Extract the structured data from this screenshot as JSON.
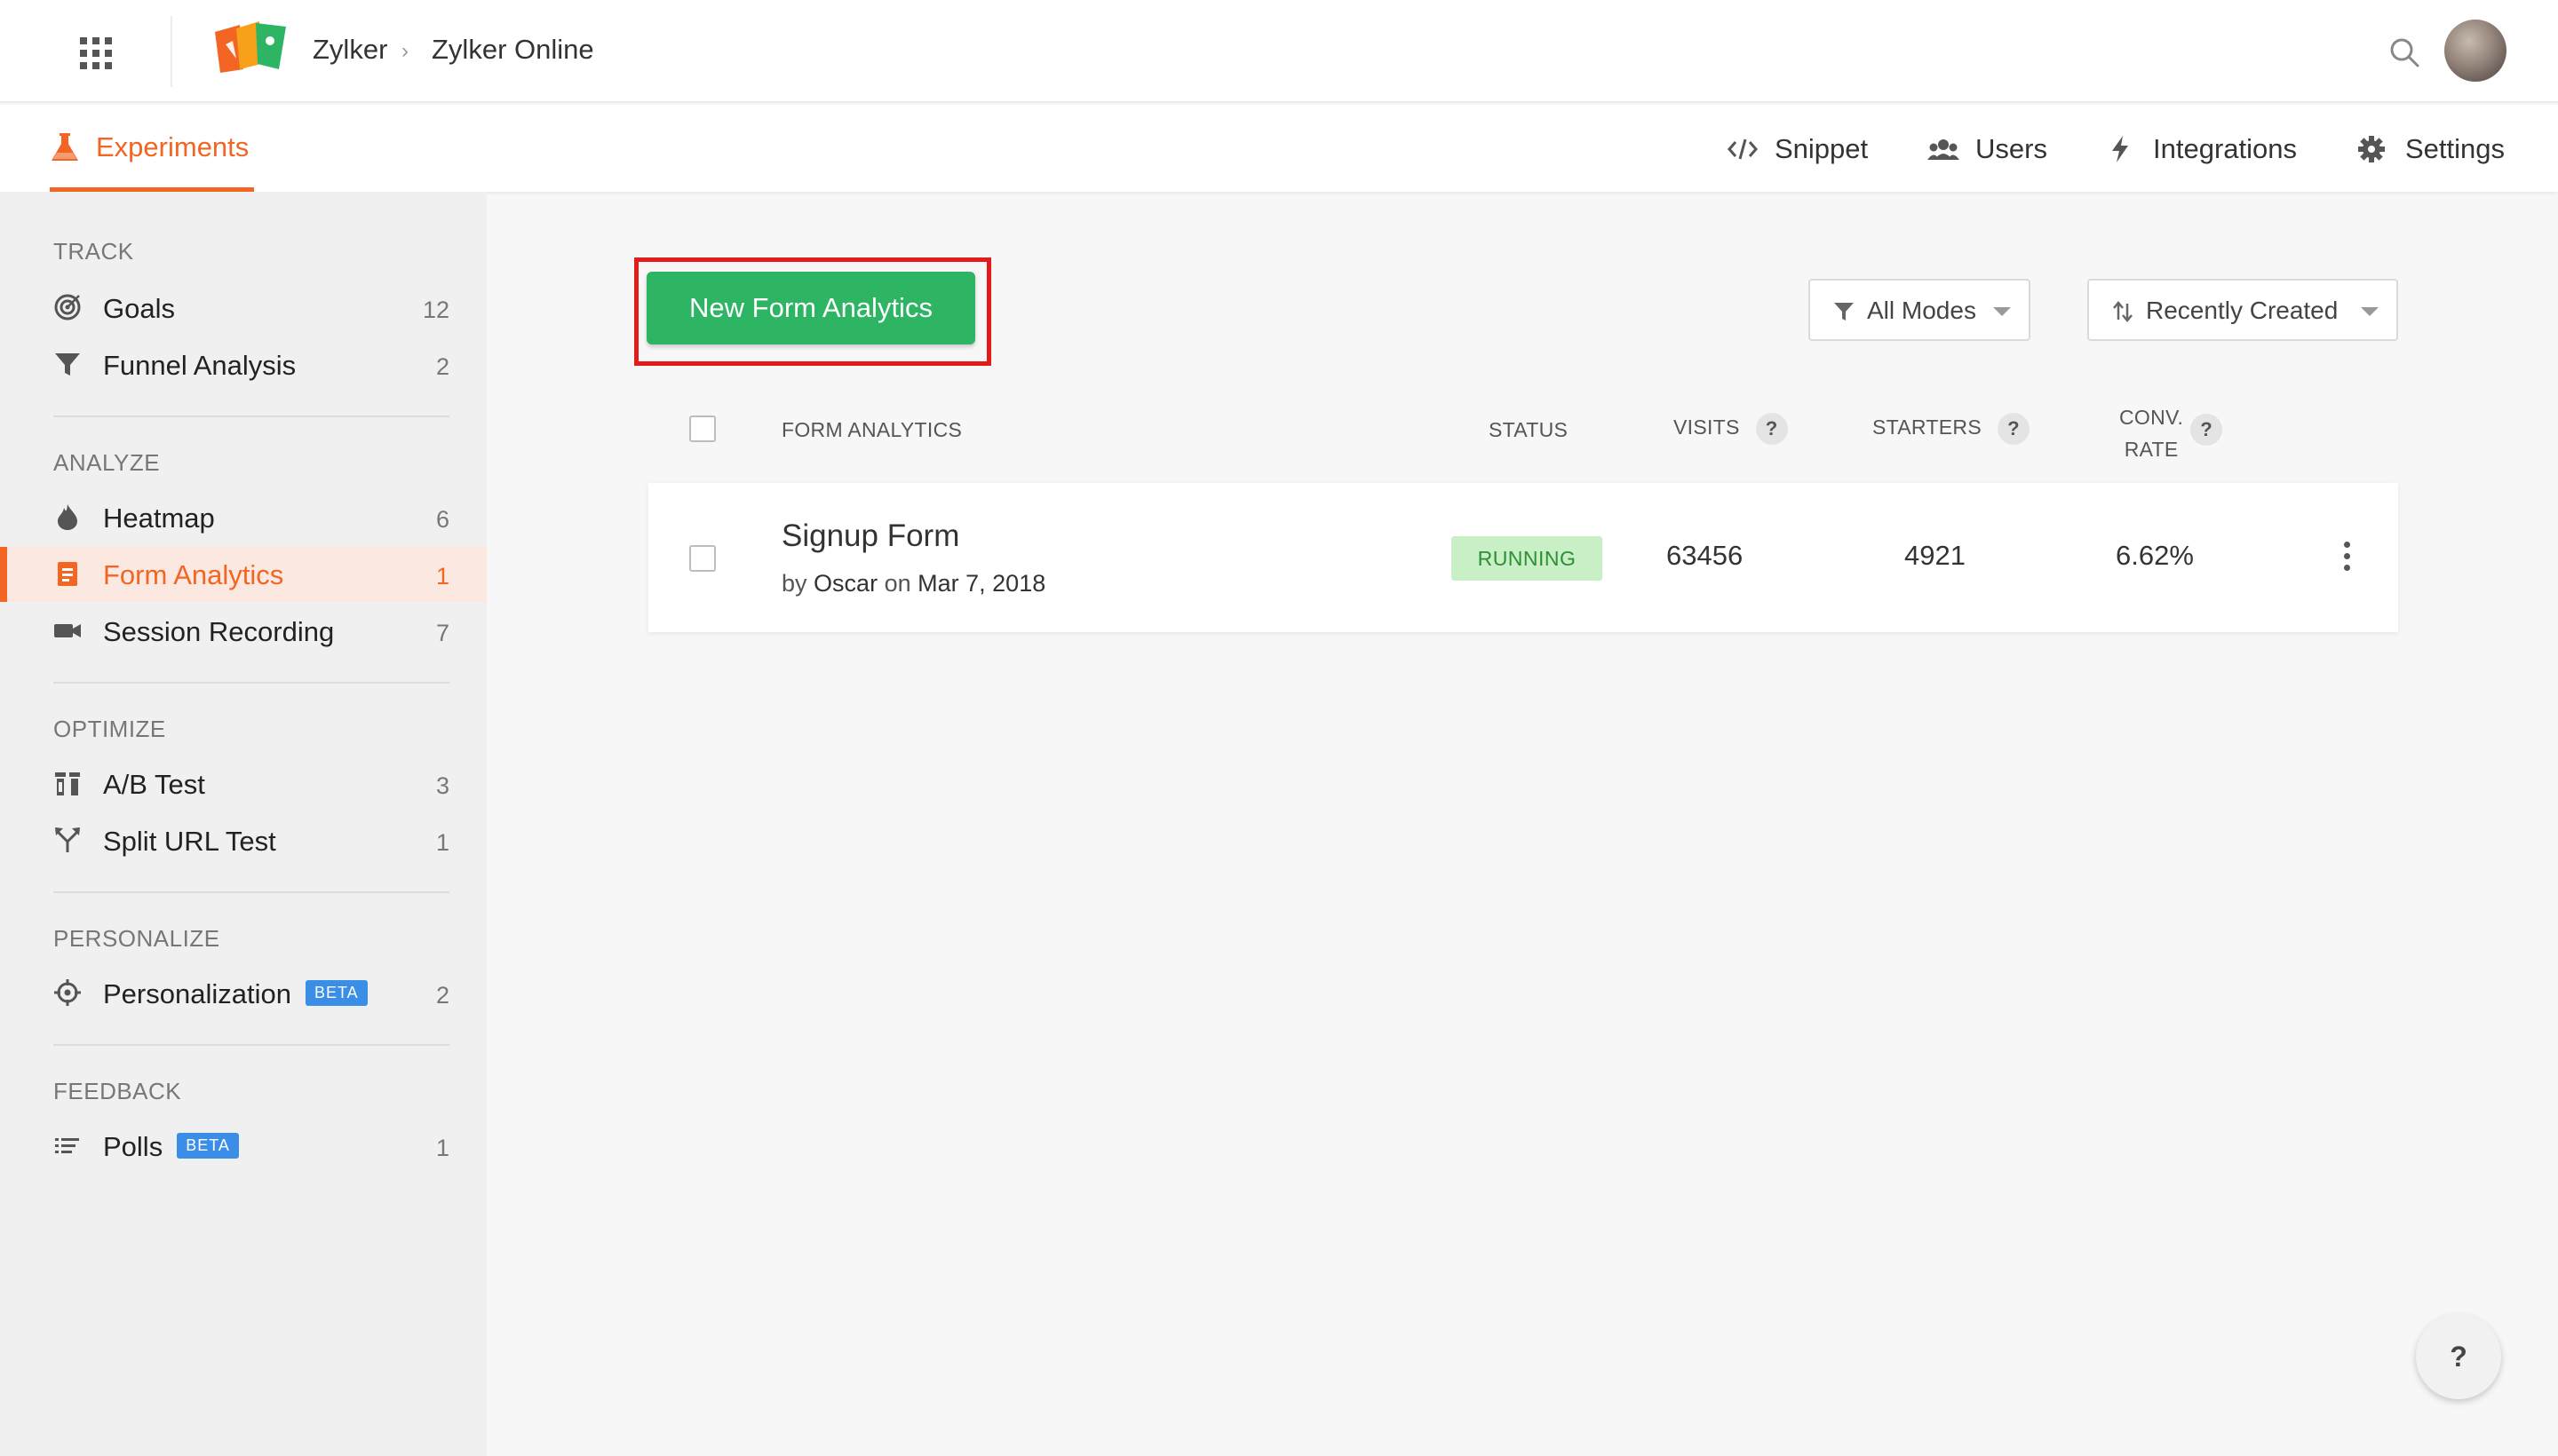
{
  "header": {
    "breadcrumb": [
      "Zylker",
      "Zylker Online"
    ]
  },
  "subnav": {
    "active_tab": "Experiments",
    "links": [
      "Snippet",
      "Users",
      "Integrations",
      "Settings"
    ]
  },
  "sidebar": {
    "sections": [
      {
        "title": "TRACK",
        "items": [
          {
            "label": "Goals",
            "count": "12",
            "icon": "target-icon"
          },
          {
            "label": "Funnel Analysis",
            "count": "2",
            "icon": "funnel-icon"
          }
        ]
      },
      {
        "title": "ANALYZE",
        "items": [
          {
            "label": "Heatmap",
            "count": "6",
            "icon": "flame-icon"
          },
          {
            "label": "Form Analytics",
            "count": "1",
            "icon": "form-icon",
            "active": true
          },
          {
            "label": "Session Recording",
            "count": "7",
            "icon": "video-camera-icon"
          }
        ]
      },
      {
        "title": "OPTIMIZE",
        "items": [
          {
            "label": "A/B Test",
            "count": "3",
            "icon": "ab-test-icon"
          },
          {
            "label": "Split URL Test",
            "count": "1",
            "icon": "split-arrow-icon"
          }
        ]
      },
      {
        "title": "PERSONALIZE",
        "items": [
          {
            "label": "Personalization",
            "count": "2",
            "icon": "crosshair-icon",
            "badge": "BETA"
          }
        ]
      },
      {
        "title": "FEEDBACK",
        "items": [
          {
            "label": "Polls",
            "count": "1",
            "icon": "list-icon",
            "badge": "BETA"
          }
        ]
      }
    ]
  },
  "toolbar": {
    "new_button": "New Form Analytics",
    "mode_filter": "All Modes",
    "sort": "Recently Created"
  },
  "table": {
    "headers": {
      "name": "FORM ANALYTICS",
      "status": "STATUS",
      "visits": "VISITS",
      "starters": "STARTERS",
      "conv_line1": "CONV.",
      "conv_line2": "RATE"
    },
    "help_glyph": "?",
    "rows": [
      {
        "title": "Signup Form",
        "by_prefix": "by",
        "author": "Oscar",
        "on_word": "on",
        "date": "Mar 7, 2018",
        "status": "RUNNING",
        "visits": "63456",
        "starters": "4921",
        "conv_rate": "6.62%"
      }
    ]
  },
  "help_button": "?",
  "colors": {
    "accent": "#f26522",
    "primary_button": "#2db563",
    "highlight_border": "#e31b1b",
    "status_bg": "#c9efc7",
    "status_text": "#2d8f32",
    "beta_badge": "#3a8ee6"
  }
}
